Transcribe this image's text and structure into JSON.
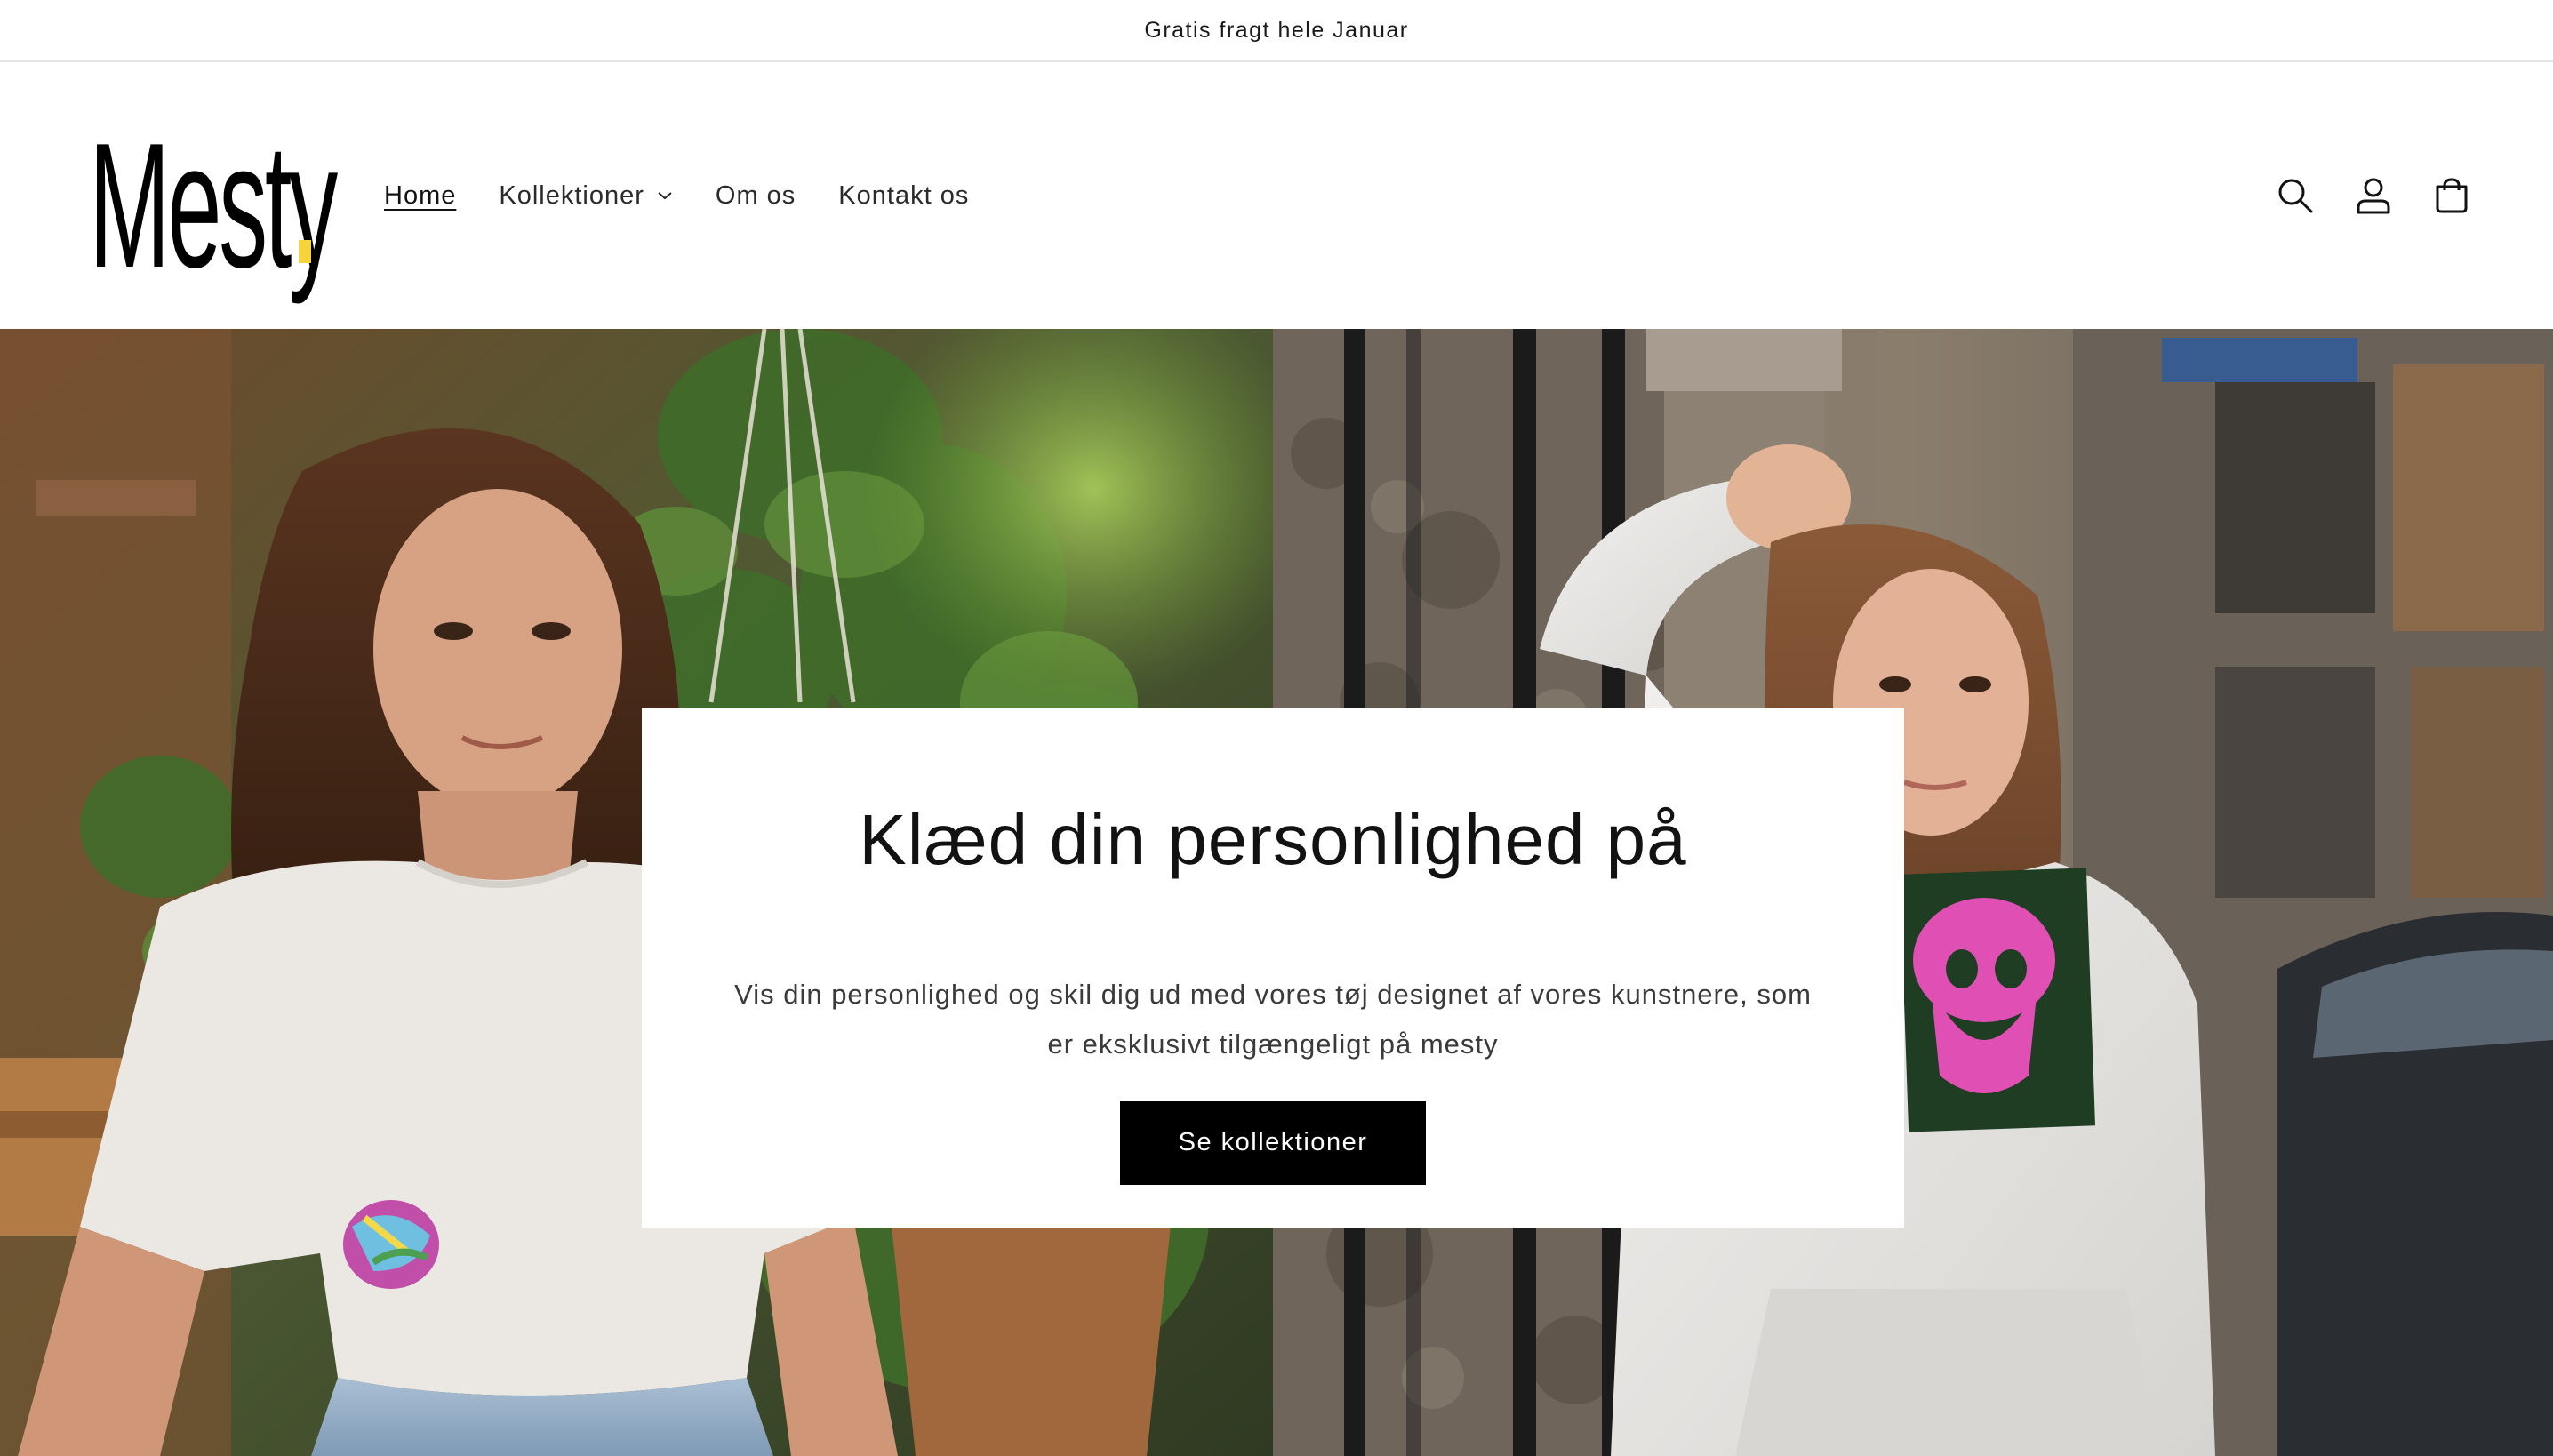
{
  "announcement": {
    "text": "Gratis fragt hele Januar"
  },
  "header": {
    "logo_text": "Mesty",
    "nav": {
      "home": "Home",
      "collections": "Kollektioner",
      "about": "Om os",
      "contact": "Kontakt os"
    },
    "icons": [
      "search-icon",
      "account-icon",
      "cart-icon"
    ]
  },
  "hero": {
    "title": "Klæd din personlighed på",
    "text": "Vis din personlighed og skil dig ud med vores tøj designet af vores kunstnere, som er eksklusivt tilgængeligt på mesty",
    "button_label": "Se kollektioner"
  },
  "colors": {
    "accent": "#f7d43a",
    "button_bg": "#000000",
    "text": "#121212"
  }
}
